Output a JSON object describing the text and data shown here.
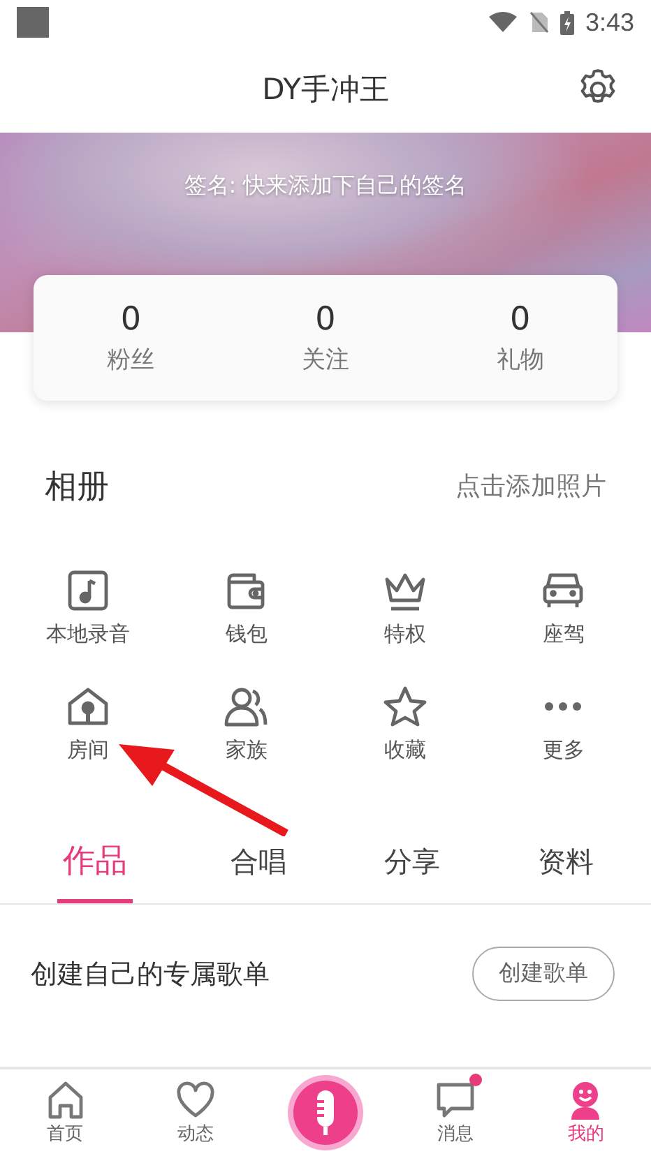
{
  "status_bar": {
    "time": "3:43"
  },
  "header": {
    "title": "DY手冲王"
  },
  "banner": {
    "signature": "签名: 快来添加下自己的签名"
  },
  "stats": [
    {
      "value": "0",
      "label": "粉丝"
    },
    {
      "value": "0",
      "label": "关注"
    },
    {
      "value": "0",
      "label": "礼物"
    }
  ],
  "album": {
    "title": "相册",
    "action": "点击添加照片"
  },
  "features": [
    {
      "kind": "music",
      "label": "本地录音"
    },
    {
      "kind": "wallet",
      "label": "钱包"
    },
    {
      "kind": "crown",
      "label": "特权"
    },
    {
      "kind": "car",
      "label": "座驾"
    },
    {
      "kind": "room",
      "label": "房间"
    },
    {
      "kind": "family",
      "label": "家族"
    },
    {
      "kind": "star",
      "label": "收藏"
    },
    {
      "kind": "more",
      "label": "更多"
    }
  ],
  "tabs": [
    {
      "label": "作品",
      "selected": true
    },
    {
      "label": "合唱",
      "selected": false
    },
    {
      "label": "分享",
      "selected": false
    },
    {
      "label": "资料",
      "selected": false
    }
  ],
  "playlist": {
    "text": "创建自己的专属歌单",
    "button": "创建歌单"
  },
  "nav": [
    {
      "kind": "home",
      "label": "首页",
      "selected": false,
      "unread": false
    },
    {
      "kind": "heart",
      "label": "动态",
      "selected": false,
      "unread": false
    },
    {
      "kind": "mic",
      "selected": false,
      "unread": false
    },
    {
      "kind": "message",
      "label": "消息",
      "selected": false,
      "unread": true
    },
    {
      "kind": "profile",
      "label": "我的",
      "selected": true,
      "unread": false
    }
  ]
}
